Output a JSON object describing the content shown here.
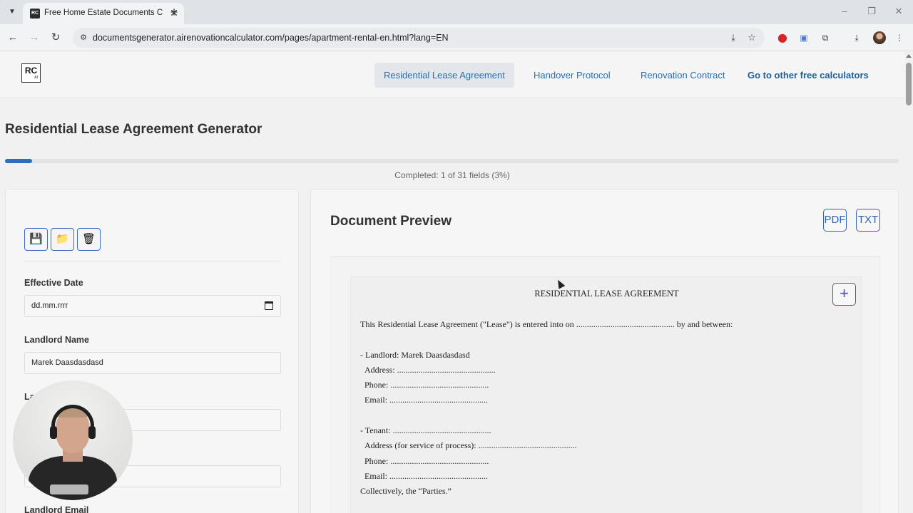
{
  "browser": {
    "tab_title": "Free Home Estate Documents C",
    "tab_favicon": "RC",
    "url": "documentsgenerator.airenovationcalculator.com/pages/apartment-rental-en.html?lang=EN"
  },
  "header": {
    "logo_text": "RC",
    "logo_sub": "AI",
    "nav": [
      {
        "label": "Residential Lease Agreement"
      },
      {
        "label": "Handover Protocol"
      },
      {
        "label": "Renovation Contract"
      },
      {
        "label": "Go to other free calculators"
      }
    ]
  },
  "main": {
    "title": "Residential Lease Agreement Generator",
    "progress_fraction": 0.03,
    "progress_text": "Completed: 1 of 31 fields (3%)"
  },
  "form": {
    "buttons": [
      {
        "icon": "floppy-disk-icon",
        "glyph": "💾"
      },
      {
        "icon": "folder-icon",
        "glyph": "📁"
      },
      {
        "icon": "trash-icon",
        "glyph": "🗑"
      }
    ],
    "fields": [
      {
        "label": "Effective Date",
        "value": "dd.mm.rrrr"
      },
      {
        "label": "Landlord Name",
        "value": "Marek Daasdasdasd"
      },
      {
        "label": "La",
        "value": ""
      },
      {
        "label": "",
        "value": ""
      },
      {
        "label": "Landlord Email",
        "value": ""
      }
    ]
  },
  "preview": {
    "title": "Document Preview",
    "pdf_label": "PDF",
    "txt_label": "TXT",
    "add_label": "+",
    "doc_title": "RESIDENTIAL LEASE AGREEMENT",
    "lines": [
      "This Residential Lease Agreement (\"Lease\") is entered into on .............................................. by and between:",
      "- Landlord: Marek Daasdasdasd",
      "Address: ..............................................",
      "Phone: ..............................................",
      "Email: ..............................................",
      "- Tenant: ..............................................",
      "Address (for service of process): ..............................................",
      "Phone: ..............................................",
      "Email: ..............................................",
      "Collectively, the “Parties.”"
    ]
  }
}
